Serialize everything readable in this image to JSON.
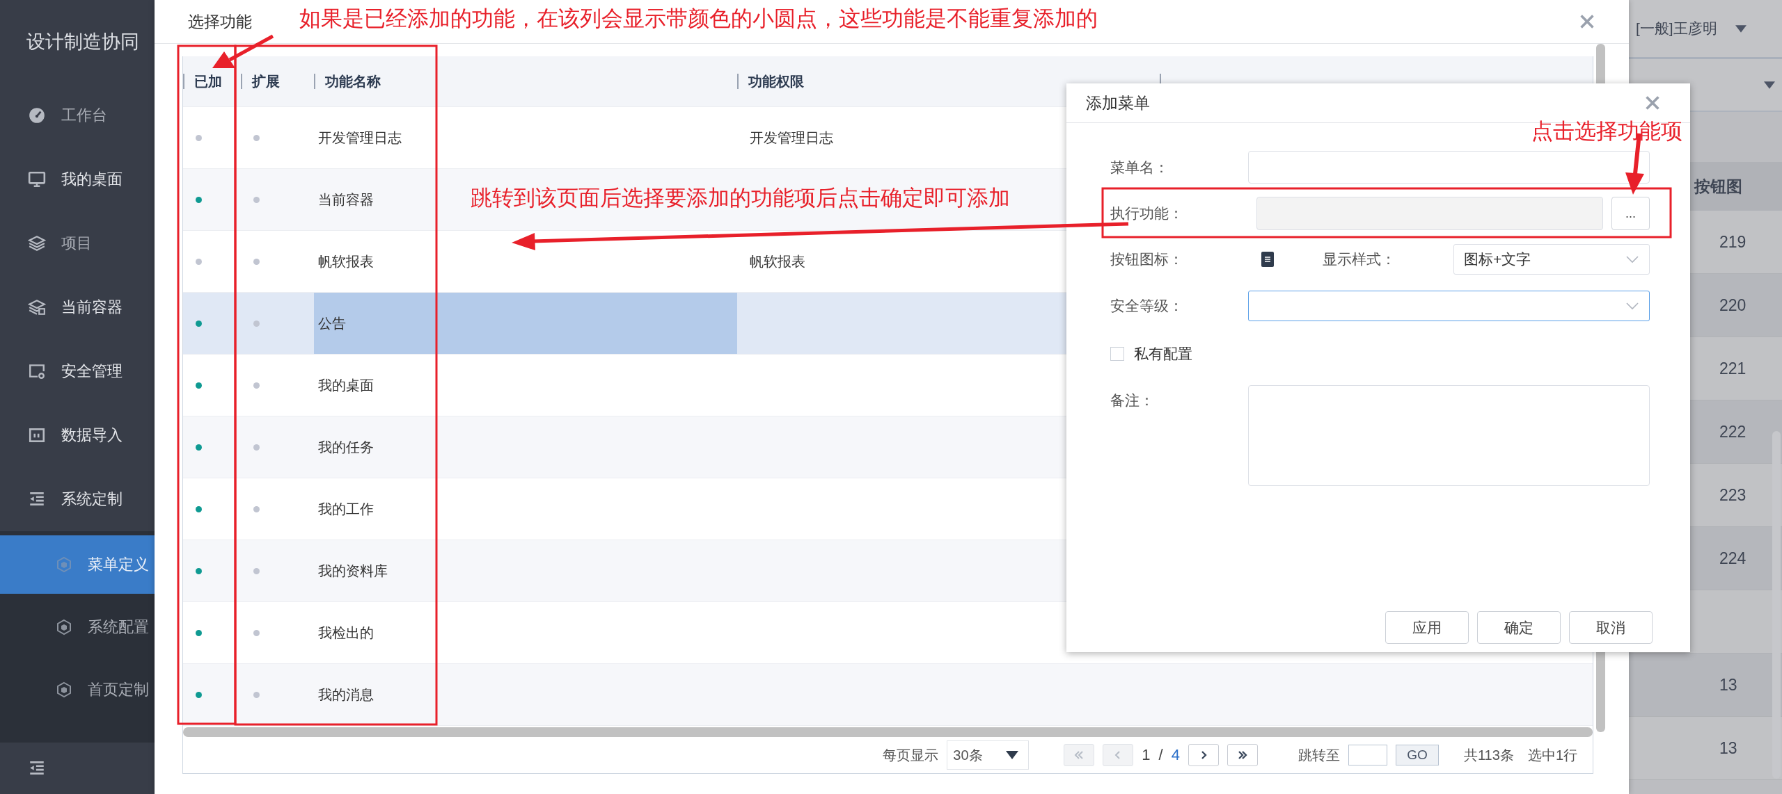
{
  "sidebar": {
    "title": "设计制造协同",
    "items": [
      {
        "label": "工作台",
        "dimmed": true
      },
      {
        "label": "我的桌面",
        "dimmed": false
      },
      {
        "label": "项目",
        "dimmed": true
      },
      {
        "label": "当前容器",
        "dimmed": false
      },
      {
        "label": "安全管理",
        "dimmed": false
      },
      {
        "label": "数据导入",
        "dimmed": false
      },
      {
        "label": "系统定制",
        "dimmed": false,
        "expanded": true,
        "children": [
          {
            "label": "菜单定义",
            "selected": true
          },
          {
            "label": "系统配置",
            "selected": false
          },
          {
            "label": "首页定制",
            "selected": false
          }
        ]
      }
    ]
  },
  "background": {
    "user": "[一般]王彦明",
    "column": "按钮图",
    "rows": [
      {
        "kind": "value",
        "cell": "219"
      },
      {
        "kind": "value",
        "cell": "220"
      },
      {
        "kind": "value",
        "cell": "221"
      },
      {
        "kind": "value",
        "cell": "222"
      },
      {
        "kind": "value",
        "cell": "223"
      },
      {
        "kind": "value",
        "cell": "224"
      },
      {
        "kind": "empty"
      },
      {
        "kind": "value",
        "cell": "13"
      },
      {
        "kind": "value",
        "cell": "13"
      }
    ]
  },
  "select_dialog": {
    "title": "选择功能",
    "columns": [
      "已加",
      "扩展",
      "功能名称",
      "功能权限"
    ],
    "rows": [
      {
        "added": false,
        "extended": false,
        "name": "开发管理日志",
        "permission": "开发管理日志",
        "selected": false
      },
      {
        "added": true,
        "extended": false,
        "name": "当前容器",
        "selected": false
      },
      {
        "added": false,
        "extended": false,
        "name": "帆软报表",
        "permission": "帆软报表",
        "selected": false
      },
      {
        "added": true,
        "extended": false,
        "name": "公告",
        "selected": true
      },
      {
        "added": true,
        "extended": false,
        "name": "我的桌面",
        "selected": false
      },
      {
        "added": true,
        "extended": false,
        "name": "我的任务",
        "selected": false
      },
      {
        "added": true,
        "extended": false,
        "name": "我的工作",
        "selected": false
      },
      {
        "added": true,
        "extended": false,
        "name": "我的资料库",
        "selected": false
      },
      {
        "added": true,
        "extended": false,
        "name": "我检出的",
        "selected": false
      },
      {
        "added": true,
        "extended": false,
        "name": "我的消息",
        "selected": false
      }
    ],
    "pagination": {
      "page_size_label": "每页显示",
      "page_size": "30条",
      "prev_disabled": true,
      "next_disabled": false,
      "page": "1",
      "separator": "/",
      "page_total": "4",
      "jump_label": "跳转至",
      "go": "GO",
      "total": "共113条",
      "selected_count": "选中1行"
    }
  },
  "add_dialog": {
    "title": "添加菜单",
    "menu_name": {
      "label": "菜单名："
    },
    "function": {
      "label": "执行功能：",
      "button": "..."
    },
    "icon": {
      "label": "按钮图标："
    },
    "style": {
      "label": "显示样式：",
      "value": "图标+文字"
    },
    "security": {
      "label": "安全等级：",
      "focused": true
    },
    "private": {
      "label": "私有配置",
      "checked": false
    },
    "remark": {
      "label": "备注："
    },
    "buttons": [
      "应用",
      "确定",
      "取消"
    ]
  },
  "annotations": [
    "如果是已经添加的功能，在该列会显示带颜色的小圆点，这些功能是不能重复添加的",
    "跳转到该页面后选择要添加的功能项后点击确定即可添加",
    "点击选择功能项"
  ]
}
